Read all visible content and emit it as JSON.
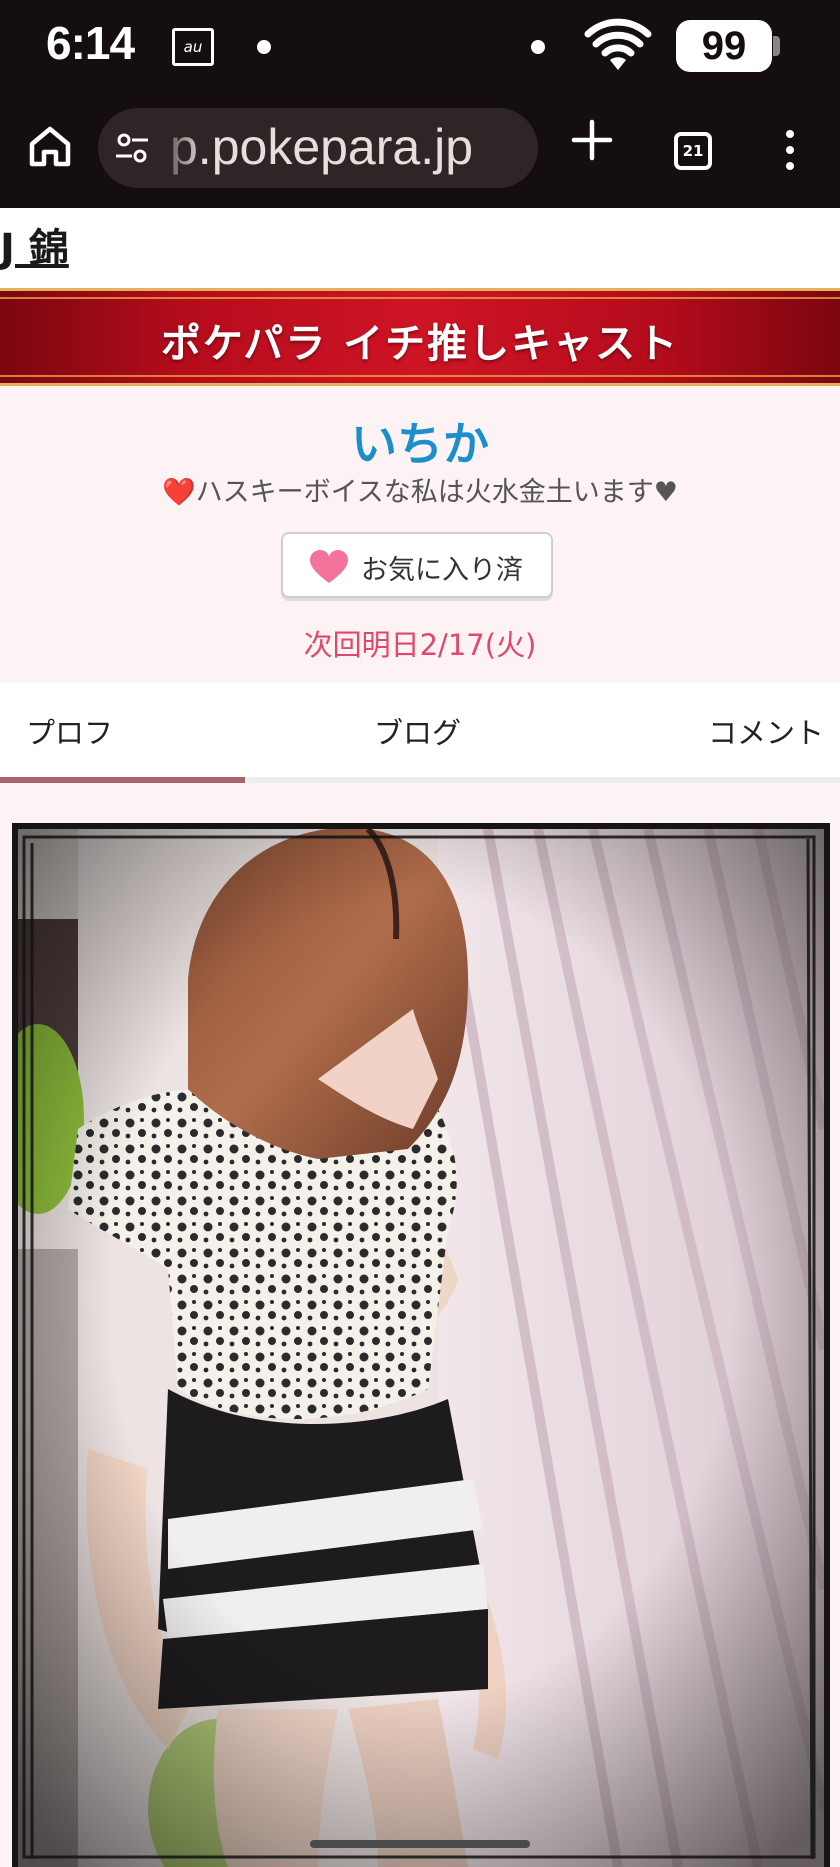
{
  "status_bar": {
    "time": "6:14",
    "carrier_icon": "au-icon",
    "battery": "99"
  },
  "browser": {
    "url": "p.pokepara.jp",
    "tab_count": "21"
  },
  "page": {
    "site_link": "J 錦",
    "banner_title": "ポケパラ イチ推しキャスト",
    "cast": {
      "name": "いちか",
      "comment_heart": "❤️",
      "comment": "ハスキーボイスな私は火水金土います♥",
      "favorite_button_label": "お気に入り済",
      "next_schedule": "次回明日2/17(火)"
    },
    "tabs": [
      {
        "label": "プロフ",
        "active": true
      },
      {
        "label": "ブログ",
        "active": false
      },
      {
        "label": "コメント",
        "active": false
      }
    ]
  },
  "colors": {
    "banner_red": "#cf1425",
    "name_blue": "#1a8fc9",
    "schedule_pink": "#e0486b",
    "heart_pink": "#f4739a",
    "tab_indicator": "#a8646a"
  }
}
